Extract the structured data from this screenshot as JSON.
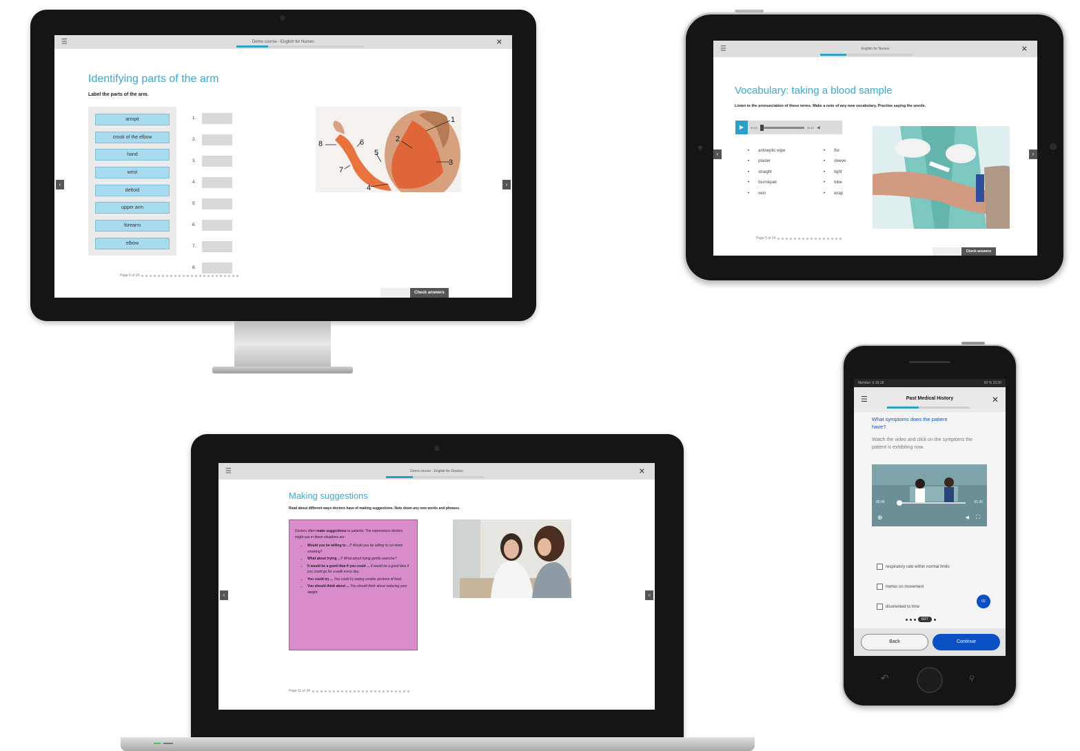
{
  "desktop": {
    "course_title": "Demo course - English for Nurses",
    "heading": "Identifying parts of the arm",
    "instruction": "Label the parts of the arm.",
    "word_bank": [
      "armpit",
      "crook of the elbow",
      "hand",
      "wrist",
      "deltoid",
      "upper arm",
      "forearm",
      "elbow"
    ],
    "answer_numbers": [
      "1.",
      "2.",
      "3.",
      "4.",
      "5.",
      "6.",
      "7.",
      "8."
    ],
    "image_labels": [
      "1",
      "2",
      "3",
      "4",
      "5",
      "6",
      "7",
      "8"
    ],
    "page_indicator": "Page 6 of 24",
    "check_label": "Check answers"
  },
  "tablet": {
    "course_title": "English for Nurses",
    "heading": "Vocabulary: taking a blood sample",
    "instruction": "Listen to the pronunciation of these terms. Make a note of any new vocabulary. Practise saying the words.",
    "audio": {
      "current": "00:00",
      "total": "00:10"
    },
    "vocab_col1": [
      "antiseptic wipe",
      "plaster",
      "straight",
      "tourniquet",
      "vein"
    ],
    "vocab_col2": [
      "fist",
      "sleeve",
      "tight",
      "tube",
      "wrap"
    ],
    "page_indicator": "Page 5 of 24",
    "check_label": "Check answers"
  },
  "laptop": {
    "course_title": "Demo course - English for Doctors",
    "heading": "Making suggestions",
    "instruction": "Read about different ways doctors have of making suggestions. Note down any new words and phrases.",
    "box_intro_pre": "Doctors often ",
    "box_intro_bold": "make suggestions",
    "box_intro_post": " to patients. The expressions doctors might use in these situations are:",
    "suggestions": [
      {
        "bold": "Would you be willing to ...?",
        "italic": "Would you be willing to cut down smoking?"
      },
      {
        "bold": "What about trying ...?",
        "italic": "What about trying gentle exercise?"
      },
      {
        "bold": "It would be a good idea if you could ...",
        "italic": "It would be a good idea if you could go for a walk every day."
      },
      {
        "bold": "You could try ...",
        "italic": "You could try eating smaller portions of food."
      },
      {
        "bold": "You should think about ...",
        "italic": "You should think about reducing your weight."
      }
    ],
    "page_indicator": "Page 11 of 24"
  },
  "phone": {
    "status_left": "Member .il 15:18",
    "status_right": "93 % 10:20",
    "title": "Past Medical History",
    "question": "What symptoms does the patient have?",
    "instruction": "Watch the video and click on the symptoms the patient is exhibiting now.",
    "video_time_start": "00:00",
    "video_time_end": "01:20",
    "options": [
      "respiratory rate within normal limits",
      "tremor on movement",
      "disoriented to time"
    ],
    "fab_label": "02",
    "page_badge": "6/27",
    "back_label": "Back",
    "continue_label": "Continue"
  },
  "colors": {
    "accent": "#38a9cf",
    "word_chip": "#a8dbef",
    "pink_box": "#d98ccb",
    "phone_blue": "#0a4fc4"
  }
}
